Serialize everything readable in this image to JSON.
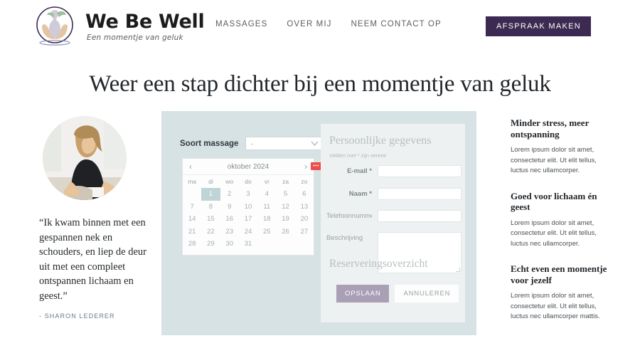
{
  "header": {
    "brand_name": "We Be Well",
    "brand_tagline": "Een momentje van geluk",
    "nav": [
      {
        "label": "MASSAGES"
      },
      {
        "label": "OVER MIJ"
      },
      {
        "label": "NEEM CONTACT OP"
      }
    ],
    "cta_label": "AFSPRAAK MAKEN",
    "cta_color": "#3c2a52"
  },
  "hero": {
    "title": "Weer een stap dichter bij een momentje van geluk"
  },
  "testimonial": {
    "quote": "“Ik kwam binnen met een gespannen nek en schouders, en liep de deur uit met een compleet ontspannen lichaam en geest.”",
    "author": "- SHARON LEDERER"
  },
  "booking": {
    "panel_color": "#d6e2e4",
    "massage_type": {
      "label": "Soort massage",
      "value": "-",
      "placeholder": "-"
    },
    "calendar": {
      "prev_label": "‹",
      "next_label": "›",
      "month": "oktober 2024",
      "badge": "•••",
      "badge_color": "#ef4b4b",
      "weekdays": [
        "ma",
        "di",
        "wo",
        "do",
        "vr",
        "za",
        "zo"
      ],
      "leading_blanks": 1,
      "days": [
        1,
        2,
        3,
        4,
        5,
        6,
        7,
        8,
        9,
        10,
        11,
        12,
        13,
        14,
        15,
        16,
        17,
        18,
        19,
        20,
        21,
        22,
        23,
        24,
        25,
        26,
        27,
        28,
        29,
        30,
        31
      ],
      "selected_day": 1,
      "selected_color": "#bed4d6"
    },
    "form": {
      "title": "Persoonlijke gegevens",
      "required_note": "Velden met * zijn vereist",
      "fields": [
        {
          "label": "E-mail *",
          "value": "",
          "type": "input"
        },
        {
          "label": "Naam *",
          "value": "",
          "type": "input"
        },
        {
          "label": "Telefoonnummer",
          "value": "",
          "type": "input"
        },
        {
          "label": "Beschrijving",
          "value": "",
          "type": "textarea"
        }
      ],
      "summary_title": "Reserveringsoverzicht",
      "save_label": "OPSLAAN",
      "cancel_label": "ANNULEREN",
      "save_color": "#a9a0b5"
    }
  },
  "features": [
    {
      "title": "Minder stress, meer ontspanning",
      "body": "Lorem ipsum dolor sit amet, consectetur elit. Ut elit tellus, luctus nec ullamcorper."
    },
    {
      "title": "Goed voor lichaam én geest",
      "body": "Lorem ipsum dolor sit amet, consectetur elit. Ut elit tellus, luctus nec ullamcorper."
    },
    {
      "title": "Echt even een momentje voor jezelf",
      "body": "Lorem ipsum dolor sit amet, consectetur elit. Ut elit tellus, luctus nec ullamcorper mattis."
    }
  ]
}
